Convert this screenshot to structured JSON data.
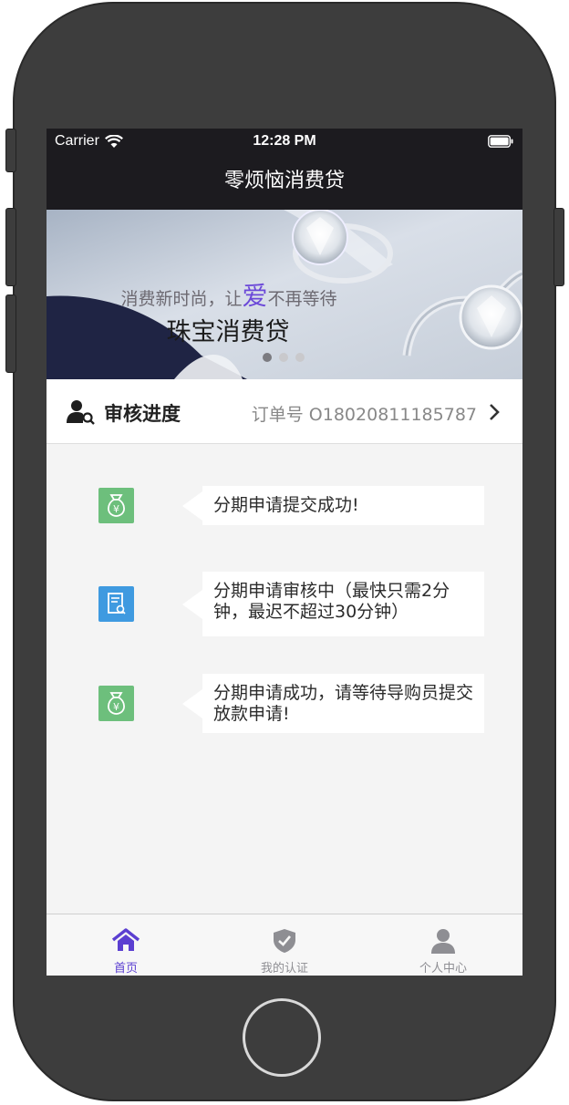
{
  "status_bar": {
    "carrier": "Carrier",
    "time": "12:28 PM"
  },
  "nav": {
    "title": "零烦恼消费贷"
  },
  "banner": {
    "tagline_prefix": "消费新时尚，让",
    "tagline_highlight": "爱",
    "tagline_suffix": "不再等待",
    "title": "珠宝消费贷",
    "page_count": 3,
    "active_page": 1
  },
  "progress": {
    "title": "审核进度",
    "order_label": "订单号 O18020811185787",
    "icon": "user-search-icon"
  },
  "timeline": [
    {
      "icon": "money-bag-icon",
      "color": "#6dbf7c",
      "text": "分期申请提交成功!"
    },
    {
      "icon": "document-search-icon",
      "color": "#3f9ae0",
      "text": "分期申请审核中（最快只需2分钟，最迟不超过30分钟）"
    },
    {
      "icon": "money-bag-icon",
      "color": "#6dbf7c",
      "text": "分期申请成功，请等待导购员提交放款申请!"
    }
  ],
  "tabs": [
    {
      "label": "首页",
      "icon": "home-icon",
      "active": true
    },
    {
      "label": "我的认证",
      "icon": "shield-check-icon",
      "active": false
    },
    {
      "label": "个人中心",
      "icon": "person-icon",
      "active": false
    }
  ],
  "colors": {
    "accent": "#5b3fd1",
    "nav_background": "#1c1b1f",
    "page_background": "#f4f4f4"
  }
}
